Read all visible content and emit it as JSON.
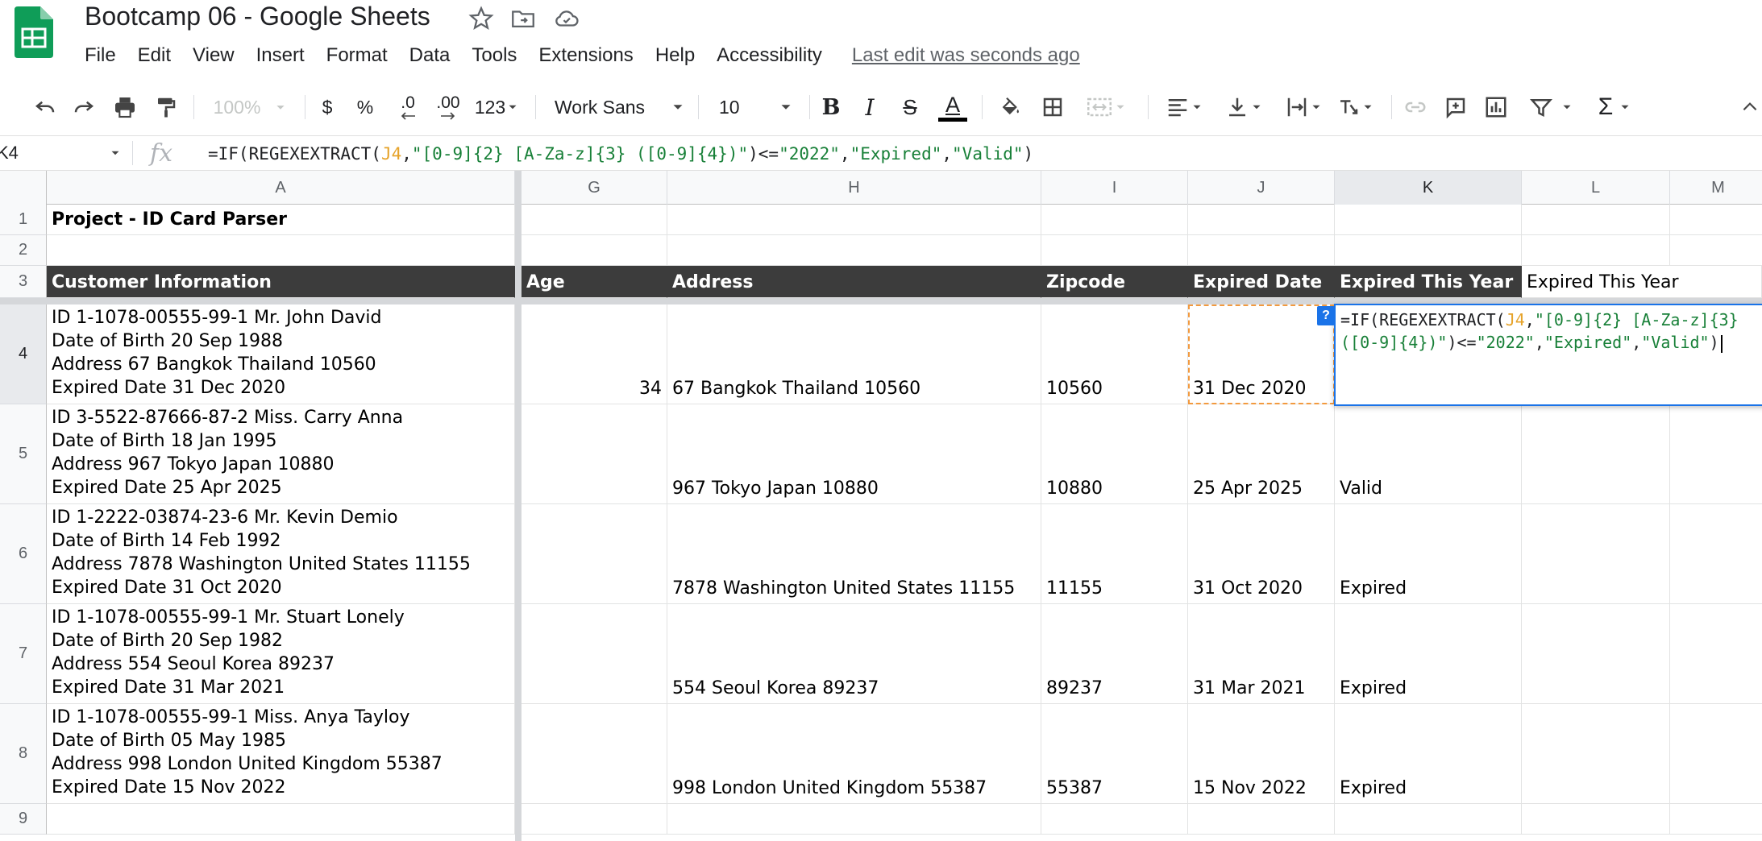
{
  "app": {
    "title": "Bootcamp 06 - Google Sheets",
    "menu": [
      "File",
      "Edit",
      "View",
      "Insert",
      "Format",
      "Data",
      "Tools",
      "Extensions",
      "Help",
      "Accessibility"
    ],
    "last_edit": "Last edit was seconds ago",
    "brand_color": "#0f9d58"
  },
  "toolbar": {
    "zoom": "100%",
    "currency": "$",
    "percent": "%",
    "decrease_decimal": ".0",
    "increase_decimal": ".00",
    "more_formats": "123",
    "font": "Work Sans",
    "font_size": "10",
    "bold": "B",
    "italic": "I",
    "strike": "S",
    "text_color": "A"
  },
  "formula_bar": {
    "name_box": "K4",
    "fx": "fx",
    "formula_parts": {
      "p1": "=IF(REGEXEXTRACT(",
      "ref": "J4",
      "p2": ",",
      "s1": "\"[0-9]{2} [A-Za-z]{3} ([0-9]{4})\"",
      "p3": ")<=",
      "s2": "\"2022\"",
      "p4": ",",
      "s3": "\"Expired\"",
      "p5": ",",
      "s4": "\"Valid\"",
      "p6": ")"
    }
  },
  "sheet": {
    "columns": [
      "A",
      "G",
      "H",
      "I",
      "J",
      "K",
      "L",
      "M"
    ],
    "rows": [
      "1",
      "2",
      "3",
      "4",
      "5",
      "6",
      "7",
      "8",
      "9"
    ],
    "title": "Project - ID Card Parser",
    "headers": {
      "a": "Customer Information",
      "g": "Age",
      "h": "Address",
      "i": "Zipcode",
      "j": "Expired Date",
      "k": "Expired This Year",
      "l": "Expired This Year"
    },
    "records": [
      {
        "info": [
          "ID 1-1078-00555-99-1 Mr. John David",
          "Date of Birth 20 Sep 1988",
          "Address 67 Bangkok Thailand 10560",
          "Expired Date 31 Dec 2020"
        ],
        "age": "34",
        "address": "67 Bangkok Thailand 10560",
        "zipcode": "10560",
        "expired_date": "31 Dec 2020",
        "status": ""
      },
      {
        "info": [
          "ID 3-5522-87666-87-2 Miss. Carry Anna",
          "Date of Birth 18 Jan 1995",
          "Address 967 Tokyo Japan 10880",
          "Expired Date 25 Apr 2025"
        ],
        "age": "",
        "address": "967 Tokyo Japan 10880",
        "zipcode": "10880",
        "expired_date": "25 Apr 2025",
        "status": "Valid"
      },
      {
        "info": [
          "ID 1-2222-03874-23-6 Mr. Kevin Demio",
          "Date of Birth 14 Feb 1992",
          "Address 7878 Washington United States 11155",
          "Expired Date 31 Oct 2020"
        ],
        "age": "",
        "address": "7878 Washington United States 11155",
        "zipcode": "11155",
        "expired_date": "31 Oct 2020",
        "status": "Expired"
      },
      {
        "info": [
          "ID 1-1078-00555-99-1 Mr. Stuart Lonely",
          "Date of Birth 20 Sep 1982",
          "Address 554 Seoul Korea 89237",
          "Expired Date 31 Mar 2021"
        ],
        "age": "",
        "address": "554 Seoul Korea 89237",
        "zipcode": "89237",
        "expired_date": "31 Mar 2021",
        "status": "Expired"
      },
      {
        "info": [
          "ID 1-1078-00555-99-1 Miss. Anya Tayloy",
          "Date of Birth 05 May 1985",
          "Address 998 London United Kingdom 55387",
          "Expired Date 15 Nov 2022"
        ],
        "age": "",
        "address": "998 London United Kingdom 55387",
        "zipcode": "55387",
        "expired_date": "15 Nov 2022",
        "status": "Expired"
      }
    ],
    "editor": {
      "help": "?",
      "line1": [
        "=IF(REGEXEXTRACT(",
        "J4",
        ",",
        "\"[0-9]{2} [A-Za-z]{3}"
      ],
      "line2": [
        "([0-9]{4})\"",
        ")<=",
        "\"2022\"",
        ",",
        "\"Expired\"",
        ",",
        "\"Valid\"",
        ")"
      ]
    }
  }
}
